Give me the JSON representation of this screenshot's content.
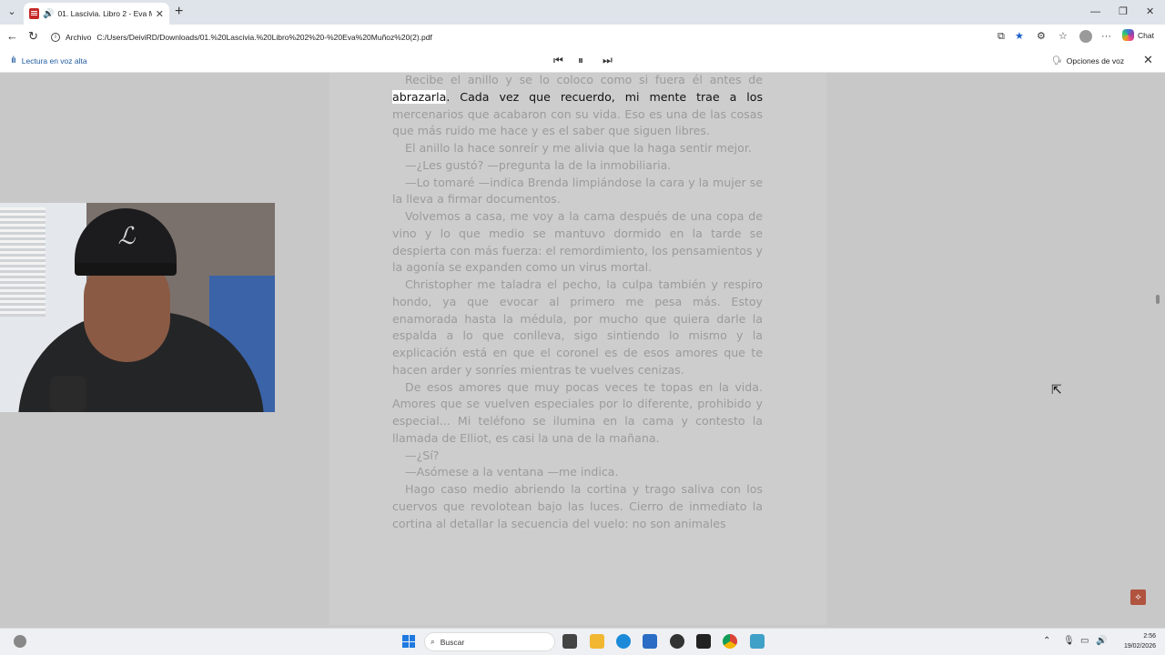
{
  "tab": {
    "title": "01. Lascivia. Libro 2 - Eva Muñ",
    "close": "✕",
    "new_tab": "+"
  },
  "window": {
    "minimize": "—",
    "restore": "❐",
    "close": "✕"
  },
  "nav": {
    "back": "←",
    "reload": "↻"
  },
  "address": {
    "label": "Archivo",
    "url": "C:/Users/DeiviRD/Downloads/01.%20Lascivia.%20Libro%202%20-%20Eva%20Muñoz%20(2).pdf"
  },
  "toolbar": {
    "copilot_label": "Chat",
    "more": "···"
  },
  "read_aloud": {
    "label": "Lectura en voz alta",
    "voice_options": "Opciones de voz",
    "close": "✕",
    "prev": "⏮",
    "pause": "⏸",
    "next": "⏭"
  },
  "document": {
    "p1_before": "Recibe el anillo y se lo coloco como si fuera él antes de",
    "p1_highlight": "abrazarla",
    "p1_current": ". Cada vez que recuerdo, mi mente trae a los",
    "p1_after": "mercenarios que acabaron con su vida. Eso es una de las cosas que más ruido me hace y es el saber que siguen libres.",
    "p2": "El anillo la hace sonreír y me alivia que la haga sentir mejor.",
    "p3": "—¿Les gustó? —pregunta la de la inmobiliaria.",
    "p4": "—Lo tomaré —indica Brenda limpiándose la cara y la mujer se la lleva a firmar documentos.",
    "p5": "Volvemos a casa, me voy a la cama después de una copa de vino y lo que medio se mantuvo dormido en la tarde se despierta con más fuerza: el remordimiento, los pensamientos y la agonía se expanden como un virus mortal.",
    "p6": "Christopher me taladra el pecho, la culpa también y respiro hondo, ya que evocar al primero me pesa más. Estoy enamorada hasta la médula, por mucho que quiera darle la espalda a lo que conlleva, sigo sintiendo lo mismo y la explicación está en que el coronel es de esos amores que te hacen arder y sonríes mientras te vuelves cenizas.",
    "p7": "De esos amores que muy pocas veces te topas en la vida. Amores que se vuelven especiales por lo diferente, prohibido y especial... Mi teléfono se ilumina en la cama y contesto la llamada de Elliot, es casi la una de la mañana.",
    "p8": "—¿Sí?",
    "p9": "—Asómese a la ventana —me indica.",
    "p10": "Hago caso medio abriendo la cortina y trago saliva con los cuervos que revolotean bajo las luces. Cierro de inmediato la cortina al detallar la secuencia del vuelo: no son animales"
  },
  "taskbar": {
    "search_placeholder": "Buscar",
    "time": "2:56",
    "date": "19/02/2026"
  }
}
